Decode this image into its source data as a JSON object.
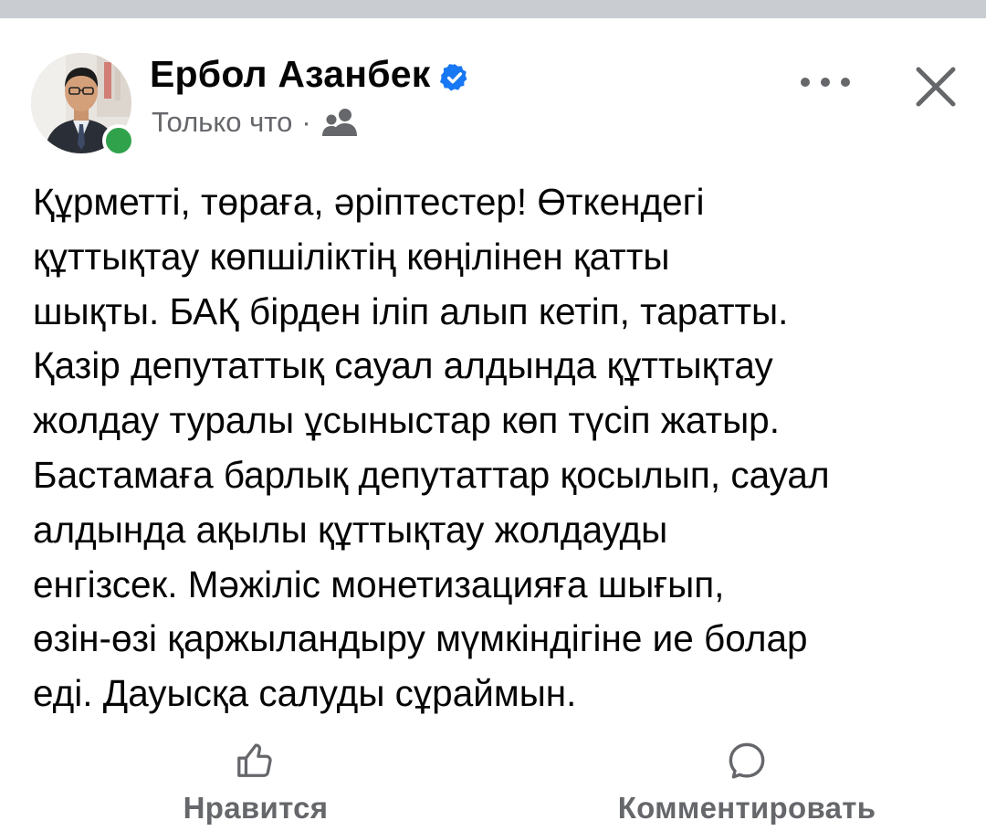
{
  "post": {
    "author": {
      "name": "Ербол Азанбек",
      "verified": true,
      "online": true,
      "avatar_icon": "profile-photo"
    },
    "timestamp": "Только что",
    "separator": "·",
    "audience_icon": "friends-icon",
    "text": "Құрметті, төраға, әріптестер! Өткендегі\nқұттықтау көпшіліктің көңілінен қатты\nшықты. БАҚ бірден іліп алып кетіп, таратты.\nҚазір депутаттық сауал алдында құттықтау\nжолдау туралы ұсыныстар көп түсіп жатыр.\nБастамаға барлық депутаттар қосылып, сауал\nалдында ақылы құттықтау жолдауды\nенгізсек. Мәжіліс монетизацияға шығып,\nөзін-өзі қаржыландыру мүмкіндігіне ие болар\nеді. Дауысқа салуды сұраймын."
  },
  "header_controls": {
    "more_icon": "more-options-icon",
    "close_icon": "close-icon"
  },
  "actions": {
    "like_label": "Нравится",
    "comment_label": "Комментировать"
  },
  "colors": {
    "verified": "#1877f2",
    "online": "#31a24c",
    "secondary_text": "#65676b",
    "divider": "#c9ccd1"
  }
}
